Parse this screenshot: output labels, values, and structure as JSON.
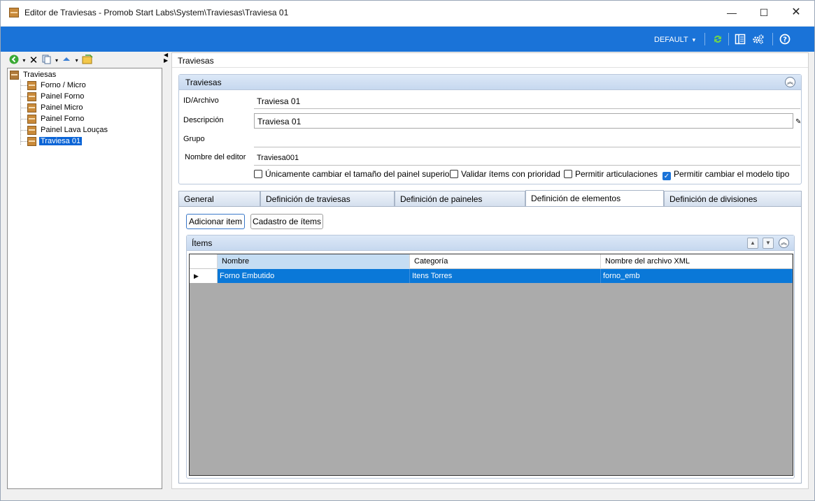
{
  "window": {
    "title": "Editor de Traviesas - Promob Start Labs\\System\\Traviesas\\Traviesa 01",
    "minimize": "—",
    "maximize": "☐",
    "close": "✕"
  },
  "toolbar": {
    "profile_label": "DEFAULT",
    "profile_arrow": "▾",
    "icons": [
      "refresh-icon",
      "layout-icon",
      "settings-icon",
      "help-icon"
    ]
  },
  "tree": {
    "root": "Traviesas",
    "items": [
      {
        "label": "Forno / Micro"
      },
      {
        "label": "Painel Forno"
      },
      {
        "label": "Painel Micro"
      },
      {
        "label": "Painel Forno"
      },
      {
        "label": "Painel Lava Louças"
      },
      {
        "label": "Traviesa 01",
        "selected": true
      }
    ]
  },
  "breadcrumb": "Traviesas",
  "group": {
    "title": "Traviesas",
    "fields": {
      "id_label": "ID/Archivo",
      "id_value": "Traviesa 01",
      "desc_label": "Descripción",
      "desc_value": "Traviesa 01",
      "group_label": "Grupo",
      "group_value": "",
      "editor_label": "Nombre del editor",
      "editor_value": "Traviesa001"
    },
    "checkboxes": [
      {
        "label": "Únicamente cambiar el tamaño del painel superior",
        "checked": false
      },
      {
        "label": "Validar ítems con prioridad",
        "checked": false
      },
      {
        "label": "Permitir articulaciones",
        "checked": false
      },
      {
        "label": "Permitir cambiar el modelo tipo",
        "checked": true
      }
    ]
  },
  "tabs": [
    {
      "label": "General"
    },
    {
      "label": "Definición de traviesas"
    },
    {
      "label": "Definición de paineles"
    },
    {
      "label": "Definición de elementos",
      "active": true
    },
    {
      "label": "Definición de divisiones"
    }
  ],
  "buttons": {
    "add_item": "Adicionar item",
    "register_items": "Cadastro de ítems"
  },
  "items": {
    "title": "Ítems",
    "columns": [
      "Nombre",
      "Categoría",
      "Nombre del archivo XML"
    ],
    "rows": [
      {
        "nombre": "Forno Embutido",
        "categoria": "Itens Torres",
        "archivo": "forno_emb"
      }
    ]
  }
}
